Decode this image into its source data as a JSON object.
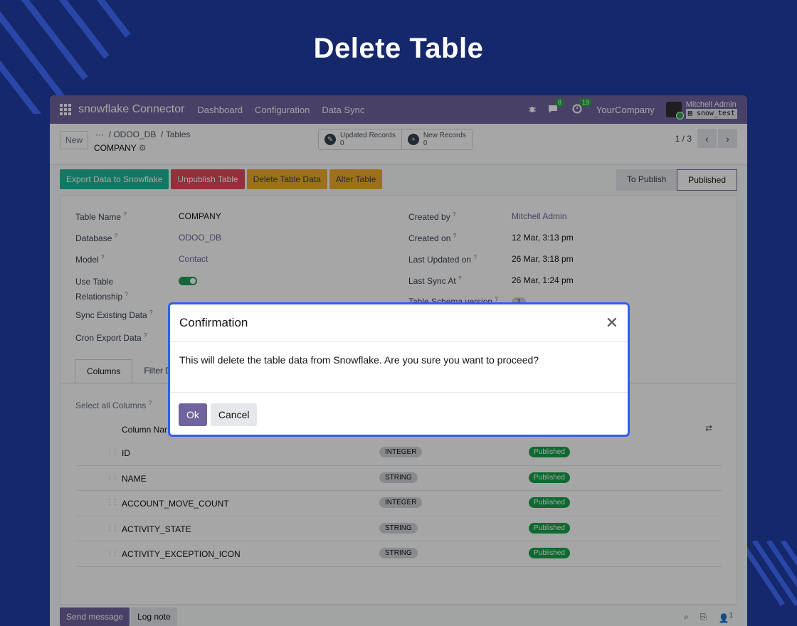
{
  "page_title": "Delete Table",
  "navbar": {
    "brand": "snowflake Connector",
    "links": [
      "Dashboard",
      "Configuration",
      "Data Sync"
    ],
    "messages_count": "8",
    "activities_count": "19",
    "company": "YourCompany",
    "user_name": "Mitchell Admin",
    "db_name": "snow_test"
  },
  "control": {
    "new_label": "New",
    "ellipsis": "···",
    "breadcrumb_db": "ODOO_DB",
    "breadcrumb_tables": "Tables",
    "record_name": "COMPANY",
    "updated_records_label": "Updated Records",
    "updated_records_count": "0",
    "new_records_label": "New Records",
    "new_records_count": "0",
    "pager": "1 / 3"
  },
  "actions": {
    "export": "Export Data to Snowflake",
    "unpublish": "Unpublish Table",
    "delete": "Delete Table Data",
    "alter": "Alter Table",
    "status_to_publish": "To Publish",
    "status_published": "Published"
  },
  "colors": {
    "export": "#21b799",
    "unpublish": "#e3495d",
    "delete": "#f0ac2d",
    "alter": "#f0ac2d"
  },
  "form": {
    "table_name_label": "Table Name",
    "table_name": "COMPANY",
    "database_label": "Database",
    "database": "ODOO_DB",
    "model_label": "Model",
    "model": "Contact",
    "use_table_label_1": "Use Table",
    "use_table_label_2": "Relationship",
    "sync_existing_label": "Sync Existing Data",
    "cron_export_label": "Cron Export Data",
    "created_by_label": "Created by",
    "created_by": "Mitchell Admin",
    "created_on_label": "Created on",
    "created_on": "12 Mar, 3:13 pm",
    "last_updated_label": "Last Updated on",
    "last_updated": "26 Mar, 3:18 pm",
    "last_sync_label": "Last Sync At",
    "last_sync": "26 Mar, 1:24 pm",
    "schema_version_label": "Table Schema version",
    "schema_version": "2",
    "help_mark": "?"
  },
  "tabs": {
    "columns": "Columns",
    "filter": "Filter D"
  },
  "columns": {
    "select_all": "Select all Columns",
    "header": "Column Nar",
    "rows": [
      {
        "name": "ID",
        "type": "INTEGER",
        "status": "Published"
      },
      {
        "name": "NAME",
        "type": "STRING",
        "status": "Published"
      },
      {
        "name": "ACCOUNT_MOVE_COUNT",
        "type": "INTEGER",
        "status": "Published"
      },
      {
        "name": "ACTIVITY_STATE",
        "type": "STRING",
        "status": "Published"
      },
      {
        "name": "ACTIVITY_EXCEPTION_ICON",
        "type": "STRING",
        "status": "Published"
      }
    ]
  },
  "chatter": {
    "send_message": "Send message",
    "log_note": "Log note",
    "followers": "1"
  },
  "modal": {
    "title": "Confirmation",
    "body": "This will delete the table data from Snowflake. Are you sure you want to proceed?",
    "ok": "Ok",
    "cancel": "Cancel"
  }
}
